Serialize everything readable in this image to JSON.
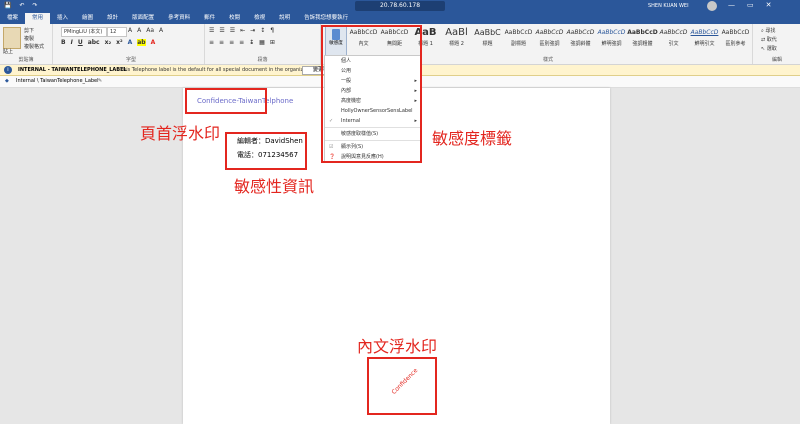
{
  "titlebar": {
    "qat": [
      "💾",
      "↶",
      "↷"
    ],
    "remote_ip": "20.78.60.178",
    "user": "SHEN KUAN WEI",
    "window": [
      "—",
      "▭",
      "✕"
    ]
  },
  "tabs": [
    "檔案",
    "常用",
    "插入",
    "繪圖",
    "設計",
    "版面配置",
    "參考資料",
    "郵件",
    "校閱",
    "檢視",
    "說明",
    "告訴我您想要執行"
  ],
  "ribbon": {
    "paste": "貼上",
    "cut": "剪下",
    "copy": "複製",
    "format_painter": "複製格式",
    "font": "PMingLiU (本文)",
    "size": "12",
    "group_clipboard": "剪貼簿",
    "group_font": "字型",
    "group_paragraph": "段落",
    "group_styles": "樣式",
    "group_editing": "編輯",
    "sensitivity": "敏感度",
    "styles": [
      {
        "prev": "AaBbCcD",
        "name": "內文"
      },
      {
        "prev": "AaBbCcD",
        "name": "無間距"
      },
      {
        "prev": "AaB",
        "name": "標題 1"
      },
      {
        "prev": "AaBl",
        "name": "標題 2"
      },
      {
        "prev": "AaBbC",
        "name": "標題"
      },
      {
        "prev": "AaBbCcD",
        "name": "副標題"
      },
      {
        "prev": "AaBbCcD",
        "name": "區別強調"
      },
      {
        "prev": "AaBbCcD",
        "name": "強調斜體"
      },
      {
        "prev": "AaBbCcD",
        "name": "鮮明強調"
      },
      {
        "prev": "AaBbCcD",
        "name": "強調粗體"
      },
      {
        "prev": "AaBbCcD",
        "name": "引文"
      },
      {
        "prev": "AaBbCcD",
        "name": "鮮明引文"
      },
      {
        "prev": "AaBbCcD",
        "name": "區別參考"
      }
    ],
    "find": "尋找",
    "replace": "取代",
    "select": "選取"
  },
  "infobar": {
    "label": "INTERNAL - TAIWANTELEPHONE_LABEL",
    "message": "This Telephone label is the default for all special document in the organize",
    "button": "變更標籤"
  },
  "labelbar": {
    "text": "Internal \\ TaiwanTelephone_Label"
  },
  "menu": {
    "items": [
      "個人",
      "公用",
      "一般",
      "內部",
      "高度機密",
      "HollyOwnerSensorSensLabel",
      "Internal",
      "敏感度取樣值(S)",
      "顯示列(S)",
      "說明與意見反應(H)"
    ]
  },
  "document": {
    "header_watermark": "Confidence-TaiwanTelphone",
    "editor": "編輯者：DavidShen",
    "phone": "電話：071234567",
    "body_watermark": "Confidence"
  },
  "annotations": {
    "header": "頁首浮水印",
    "sensitivity": "敏感度標籤",
    "info": "敏感性資訊",
    "body": "內文浮水印"
  }
}
